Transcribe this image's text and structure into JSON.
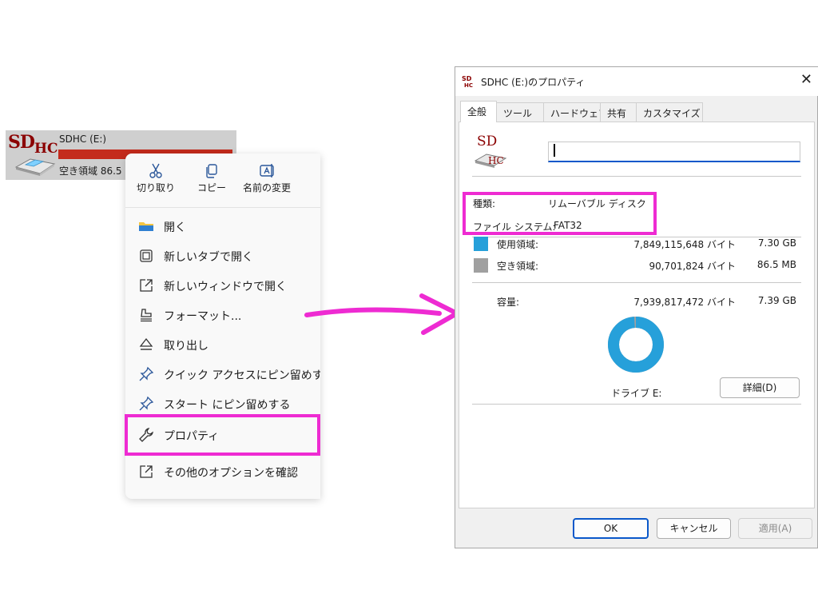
{
  "drive_tile": {
    "logo_sd": "SD",
    "logo_hc": "HC",
    "name": "SDHC (E:)",
    "free_text": "空き領域 86.5",
    "bar_color": "#c42b1c",
    "used_fraction": 0.99
  },
  "context_menu": {
    "top_actions": [
      {
        "icon": "scissors-icon",
        "label": "切り取り"
      },
      {
        "icon": "copy-icon",
        "label": "コピー"
      },
      {
        "icon": "rename-icon",
        "label": "名前の変更"
      }
    ],
    "items": [
      {
        "icon": "folder-icon",
        "label": "開く"
      },
      {
        "icon": "new-tab-icon",
        "label": "新しいタブで開く"
      },
      {
        "icon": "new-window-icon",
        "label": "新しいウィンドウで開く"
      },
      {
        "icon": "format-icon",
        "label": "フォーマット..."
      },
      {
        "icon": "eject-icon",
        "label": "取り出し"
      },
      {
        "icon": "pin-icon",
        "label": "クイック アクセスにピン留めする"
      },
      {
        "icon": "pin-icon",
        "label": "スタート にピン留めする"
      },
      {
        "icon": "wrench-icon",
        "label": "プロパティ"
      },
      {
        "icon": "more-options-icon",
        "label": "その他のオプションを確認"
      }
    ]
  },
  "dialog": {
    "title": "SDHC (E:)のプロパティ",
    "tabs": [
      "全般",
      "ツール",
      "ハードウェア",
      "共有",
      "カスタマイズ"
    ],
    "active_tab": "全般",
    "icon_sd": "SD",
    "icon_hc": "HC",
    "name_value": "",
    "type_label": "種類:",
    "type_value": "リムーバブル ディスク",
    "fs_label": "ファイル システム:",
    "fs_value": "FAT32",
    "used": {
      "label": "使用領域:",
      "bytes": "7,849,115,648 バイト",
      "size": "7.30 GB",
      "color": "#26a0da"
    },
    "free": {
      "label": "空き領域:",
      "bytes": "90,701,824 バイト",
      "size": "86.5 MB",
      "color": "#a0a0a0"
    },
    "capacity": {
      "label": "容量:",
      "bytes": "7,939,817,472 バイト",
      "size": "7.39 GB"
    },
    "used_fraction": 0.9886,
    "drive_label": "ドライブ E:",
    "details_button": "詳細(D)",
    "ok_button": "OK",
    "cancel_button": "キャンセル",
    "apply_button": "適用(A)"
  },
  "accent_colors": {
    "highlight": "#ee2bd2",
    "focus": "#0a58ca"
  }
}
